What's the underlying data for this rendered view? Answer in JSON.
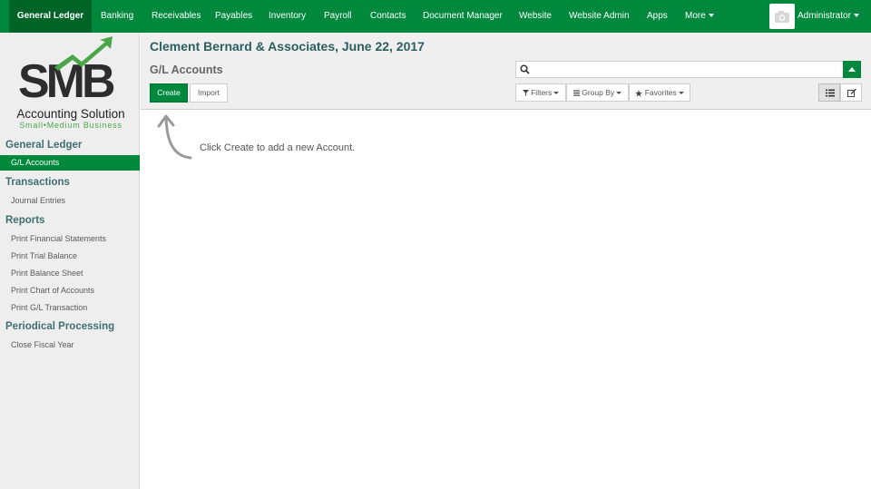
{
  "nav": {
    "items": [
      "General Ledger",
      "Banking",
      "Receivables",
      "Payables",
      "Inventory",
      "Payroll",
      "Contacts",
      "Document Manager",
      "Website",
      "Website Admin",
      "Apps",
      "More"
    ],
    "user": "Administrator",
    "accent": "#00893d"
  },
  "sidebar": {
    "logo": {
      "letters": "SMB",
      "line1": "Accounting Solution",
      "line2": "Small•Medium Business"
    },
    "sections": [
      {
        "title": "General Ledger",
        "items": [
          "G/L Accounts"
        ]
      },
      {
        "title": "Transactions",
        "items": [
          "Journal Entries"
        ]
      },
      {
        "title": "Reports",
        "items": [
          "Print Financial Statements",
          "Print Trial Balance",
          "Print Balance Sheet",
          "Print Chart of Accounts",
          "Print G/L Transaction"
        ]
      },
      {
        "title": "Periodical Processing",
        "items": [
          "Close Fiscal Year"
        ]
      }
    ]
  },
  "main": {
    "company": "Clement Bernard & Associates, June 22, 2017",
    "title": "G/L Accounts",
    "create_label": "Create",
    "import_label": "Import",
    "search_value": "",
    "filters_label": "Filters",
    "groupby_label": "Group By",
    "favorites_label": "Favorites",
    "empty_hint": "Click Create to add a new Account."
  }
}
